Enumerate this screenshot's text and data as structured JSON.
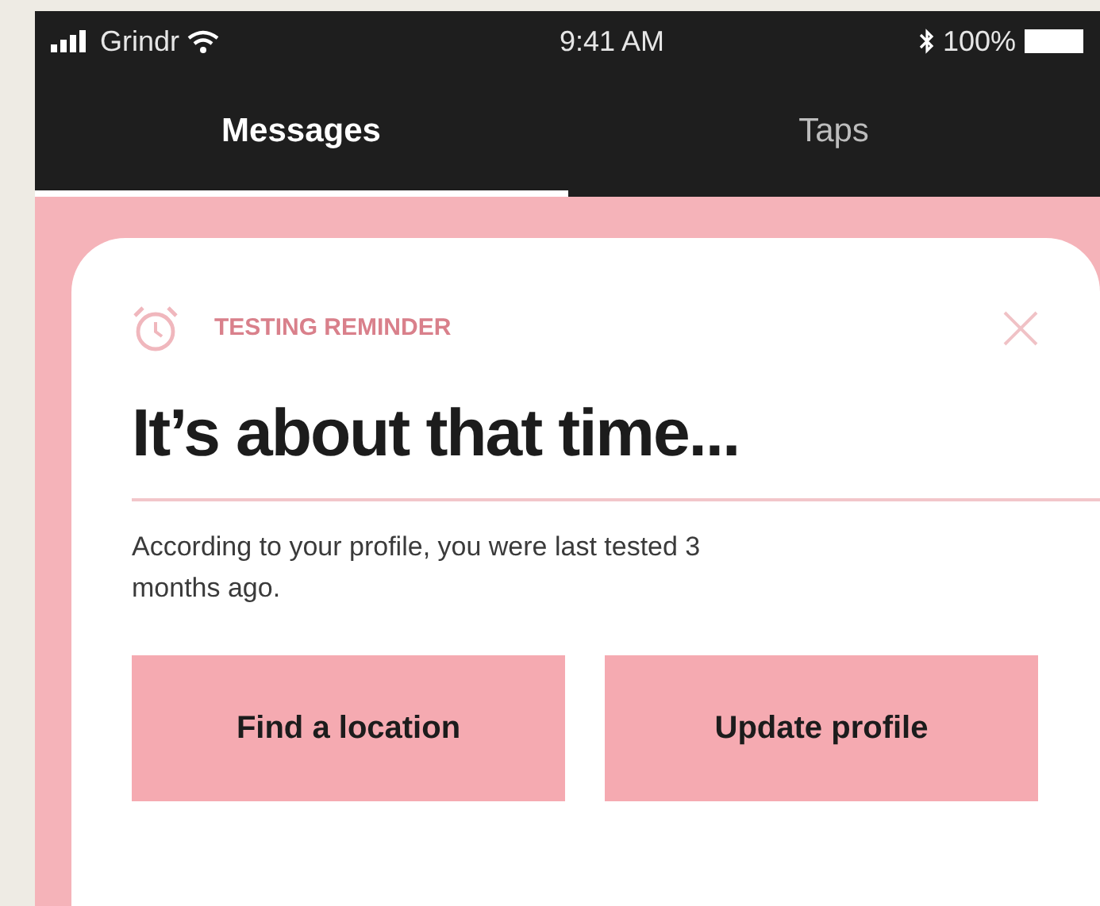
{
  "status_bar": {
    "carrier": "Grindr",
    "time": "9:41 AM",
    "battery": "100%"
  },
  "tabs": [
    {
      "label": "Messages",
      "selected": true
    },
    {
      "label": "Taps",
      "selected": false
    }
  ],
  "card": {
    "eyebrow": "TESTING REMINDER",
    "title": "It’s about that time...",
    "body": "According to your profile, you were last tested 3 months ago.",
    "buttons": [
      "Find a location",
      "Update profile"
    ]
  }
}
